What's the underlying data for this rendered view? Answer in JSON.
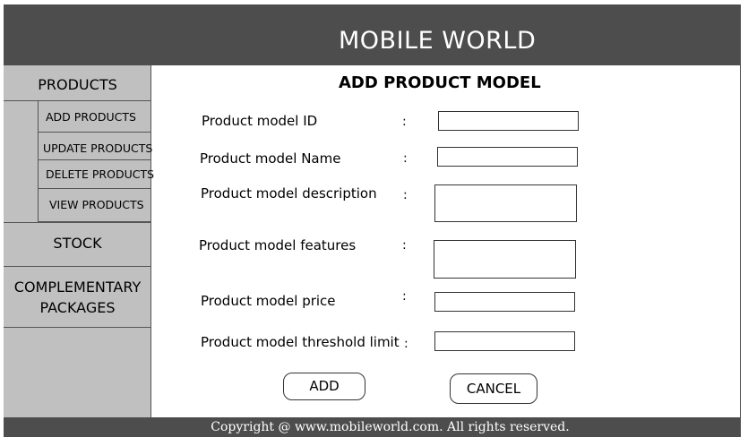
{
  "header": {
    "title": "MOBILE WORLD"
  },
  "sidebar": {
    "products": "PRODUCTS",
    "add": "ADD PRODUCTS",
    "update": "UPDATE PRODUCTS",
    "delete": "DELETE PRODUCTS",
    "view": "VIEW PRODUCTS",
    "stock": "STOCK",
    "complementary_line1": "COMPLEMENTARY",
    "complementary_line2": "PACKAGES"
  },
  "form": {
    "title": "ADD PRODUCT MODEL",
    "colon": ":",
    "fields": [
      {
        "label": "Product model ID",
        "value": ""
      },
      {
        "label": "Product model Name",
        "value": ""
      },
      {
        "label": "Product model description",
        "value": ""
      },
      {
        "label": "Product model features",
        "value": ""
      },
      {
        "label": "Product model price",
        "value": ""
      },
      {
        "label": "Product model threshold limit",
        "value": ""
      }
    ],
    "add_label": "ADD",
    "cancel_label": "CANCEL"
  },
  "footer": {
    "text": "Copyright @ www.mobileworld.com. All rights reserved."
  }
}
